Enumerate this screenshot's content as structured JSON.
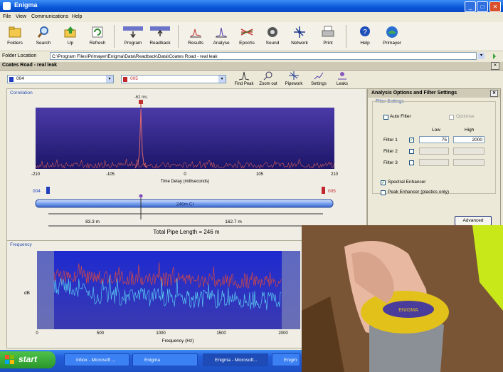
{
  "window": {
    "title": "Enigma",
    "controls": [
      "minimize",
      "maximize",
      "close"
    ]
  },
  "menu": [
    "File",
    "View",
    "Communications",
    "Help"
  ],
  "toolbar": [
    {
      "label": "Folders",
      "icon": "folders-icon"
    },
    {
      "label": "Search",
      "icon": "search-icon"
    },
    {
      "label": "Up",
      "icon": "up-folder-icon"
    },
    {
      "label": "Refresh",
      "icon": "refresh-icon"
    },
    {
      "label": "Program",
      "icon": "program-icon"
    },
    {
      "label": "Readback",
      "icon": "readback-icon"
    },
    {
      "label": "Results",
      "icon": "results-icon"
    },
    {
      "label": "Analyse",
      "icon": "analyse-icon"
    },
    {
      "label": "Epochs",
      "icon": "epochs-icon"
    },
    {
      "label": "Sound",
      "icon": "sound-icon"
    },
    {
      "label": "Network",
      "icon": "network-icon"
    },
    {
      "label": "Print",
      "icon": "print-icon"
    },
    {
      "label": "Help",
      "icon": "help-icon"
    },
    {
      "label": "Primayer",
      "icon": "primayer-icon"
    }
  ],
  "folder": {
    "label": "Folder Location",
    "path": "C:\\Program Files\\Primayer\\Enigma\\Data\\Readback\\Data\\Coates Road - real leak"
  },
  "section_title": "Coates Road - real leak",
  "loggers": {
    "left": "004",
    "right": "005",
    "left_color": "#1f3fbf",
    "right_color": "#c0262c"
  },
  "mini_tools": [
    "Find Peak",
    "Zoom out",
    "Pipework",
    "Settings",
    "Leaks"
  ],
  "correlation": {
    "title": "Correlation",
    "peak_label": "-62 ms",
    "xlabel": "Time Delay (milliseconds)",
    "ticks": [
      "-210",
      "-105",
      "0",
      "105",
      "210"
    ],
    "pipe_label": "246m CI",
    "dist_left": "83.3 m",
    "dist_right": "162.7 m",
    "total": "Total Pipe Length = 246 m",
    "sensor_left": "004",
    "sensor_right": "005"
  },
  "frequency": {
    "title": "Frequency",
    "ylabel": "dB",
    "xlabel": "Frequency (Hz)",
    "ticks": [
      "0",
      "500",
      "1000",
      "1500",
      "2000"
    ]
  },
  "options": {
    "title": "Analysis Options and Filter Settings",
    "group": "Filter Settings",
    "auto_filter": "Auto Filter",
    "optimise": "Optimise",
    "low": "Low",
    "high": "High",
    "filters": [
      {
        "name": "Filter 1",
        "checked": true,
        "low": "75",
        "high": "2000"
      },
      {
        "name": "Filter 2",
        "checked": false,
        "low": "",
        "high": ""
      },
      {
        "name": "Filter 3",
        "checked": false,
        "low": "",
        "high": ""
      }
    ],
    "spectral": "Spectral Enhancer",
    "peak": "Peak Enhancer (plastics only)",
    "advanced": "Advanced"
  },
  "taskbar": {
    "start": "start",
    "tasks": [
      "Inbox - Microsoft ...",
      "Enigma",
      "Enigma - Microsoft...",
      "Enigm"
    ]
  }
}
